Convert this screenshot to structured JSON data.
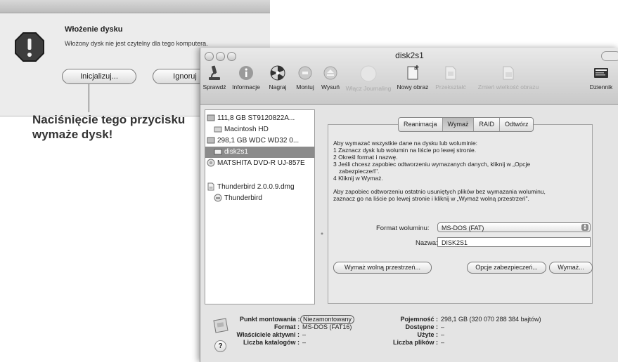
{
  "alert": {
    "title": "Włożenie dysku",
    "message": "Włożony dysk nie jest czytelny dla tego komputera.",
    "init_button": "Inicjalizuj...",
    "ignore_button": "Ignoruj",
    "callout_line1": "Naciśnięcie tego przycisku",
    "callout_line2": "wymaże dysk!"
  },
  "window": {
    "title": "disk2s1",
    "toolbar": [
      {
        "label": "Sprawdź",
        "icon": "microscope-icon"
      },
      {
        "label": "Informacje",
        "icon": "info-icon"
      },
      {
        "label": "Nagraj",
        "icon": "burn-icon"
      },
      {
        "label": "Montuj",
        "icon": "mount-icon"
      },
      {
        "label": "Wysuń",
        "icon": "eject-icon"
      },
      {
        "label": "Włącz Journaling",
        "icon": "journaling-icon"
      },
      {
        "label": "Nowy obraz",
        "icon": "new-image-icon"
      },
      {
        "label": "Przekształć",
        "icon": "convert-icon"
      },
      {
        "label": "Zmień wielkość obrazu",
        "icon": "resize-image-icon"
      },
      {
        "label": "Dziennik",
        "icon": "log-icon"
      }
    ]
  },
  "sidebar": {
    "items": [
      {
        "label": "111,8 GB ST9120822A...",
        "icon": "hard-drive-icon"
      },
      {
        "label": "Macintosh HD",
        "icon": "volume-icon"
      },
      {
        "label": "298,1 GB WDC WD32 0...",
        "icon": "hard-drive-icon"
      },
      {
        "label": "disk2s1",
        "icon": "volume-icon"
      },
      {
        "label": "MATSHITA DVD-R UJ-857E",
        "icon": "optical-drive-icon"
      },
      {
        "label": "Thunderbird 2.0.0.9.dmg",
        "icon": "disk-image-icon"
      },
      {
        "label": "Thunderbird",
        "icon": "mounted-image-icon"
      }
    ]
  },
  "tabs": [
    "Reanimacja",
    "Wymaż",
    "RAID",
    "Odtwórz"
  ],
  "erase": {
    "instructions": [
      "Aby wymazać wszystkie dane na dysku lub woluminie:",
      "1 Zaznacz dysk lub wolumin na liście po lewej stronie.",
      "2 Określ format i nazwę.",
      "3 Jeśli chcesz zapobiec odtworzeniu wymazanych danych, kliknij w „Opcje",
      "   zabezpieczeń\".",
      "4 Kliknij w Wymaż."
    ],
    "free_space_note": [
      "Aby zapobiec odtworzeniu ostatnio usuniętych plików bez wymazania woluminu,",
      "zaznacz go na liście po lewej stronie i kliknij w „Wymaż wolną przestrzeń\"."
    ],
    "format_label": "Format woluminu:",
    "format_value": "MS-DOS (FAT)",
    "name_label": "Nazwa:",
    "name_value": "DISK2S1",
    "free_space_button": "Wymaż wolną przestrzeń...",
    "security_button": "Opcje zabezpieczeń...",
    "erase_button": "Wymaż..."
  },
  "info": {
    "mount_point_label": "Punkt montowania :",
    "mount_point_value": "Niezamontowany",
    "format_label": "Format :",
    "format_value": "MS-DOS (FAT16)",
    "owners_label": "Właściciele aktywni :",
    "owners_value": "–",
    "folders_label": "Liczba katalogów :",
    "folders_value": "–",
    "capacity_label": "Pojemność :",
    "capacity_value": "298,1 GB (320 070 288 384 bajtów)",
    "available_label": "Dostępne :",
    "available_value": "–",
    "used_label": "Użyte :",
    "used_value": "–",
    "files_label": "Liczba plików :",
    "files_value": "–",
    "help": "?"
  }
}
